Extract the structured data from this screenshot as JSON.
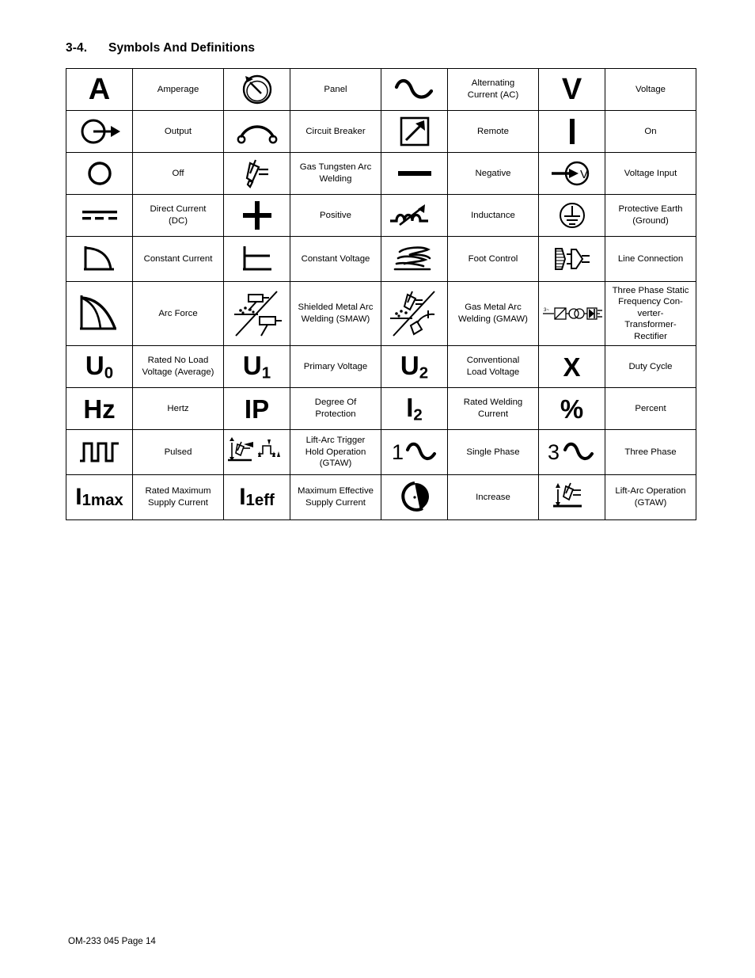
{
  "document": {
    "section_number": "3-4.",
    "section_title": "Symbols And Definitions",
    "footer": "OM-233 045 Page 14"
  },
  "table": {
    "rows": [
      {
        "cells": [
          {
            "symbol": "amperage-A-glyph",
            "symbol_text": "A",
            "label": "Amperage"
          },
          {
            "symbol": "panel-knob-icon",
            "symbol_text": "",
            "label": "Panel"
          },
          {
            "symbol": "alternating-current-sine-icon",
            "symbol_text": "",
            "label": "Alternating\nCurrent (AC)"
          },
          {
            "symbol": "voltage-V-glyph",
            "symbol_text": "V",
            "label": "Voltage"
          }
        ]
      },
      {
        "cells": [
          {
            "symbol": "output-arrow-circle-icon",
            "symbol_text": "",
            "label": "Output"
          },
          {
            "symbol": "circuit-breaker-icon",
            "symbol_text": "",
            "label": "Circuit Breaker"
          },
          {
            "symbol": "remote-arrow-box-icon",
            "symbol_text": "",
            "label": "Remote"
          },
          {
            "symbol": "on-bar-icon",
            "symbol_text": "",
            "label": "On"
          }
        ]
      },
      {
        "cells": [
          {
            "symbol": "off-circle-icon",
            "symbol_text": "",
            "label": "Off"
          },
          {
            "symbol": "gtaw-torch-icon",
            "symbol_text": "",
            "label": "Gas Tungsten Arc\nWelding"
          },
          {
            "symbol": "negative-bar-icon",
            "symbol_text": "",
            "label": "Negative"
          },
          {
            "symbol": "voltage-input-icon",
            "symbol_text": "",
            "label": "Voltage Input"
          }
        ]
      },
      {
        "cells": [
          {
            "symbol": "direct-current-dc-icon",
            "symbol_text": "",
            "label": "Direct Current\n(DC)"
          },
          {
            "symbol": "positive-plus-icon",
            "symbol_text": "",
            "label": "Positive"
          },
          {
            "symbol": "inductance-icon",
            "symbol_text": "",
            "label": "Inductance"
          },
          {
            "symbol": "protective-earth-ground-icon",
            "symbol_text": "",
            "label": "Protective Earth\n(Ground)"
          }
        ]
      },
      {
        "cells": [
          {
            "symbol": "constant-current-curve-icon",
            "symbol_text": "",
            "label": "Constant Current"
          },
          {
            "symbol": "constant-voltage-curve-icon",
            "symbol_text": "",
            "label": "Constant Voltage"
          },
          {
            "symbol": "foot-control-icon",
            "symbol_text": "",
            "label": "Foot Control"
          },
          {
            "symbol": "line-connection-plug-icon",
            "symbol_text": "",
            "label": "Line Connection"
          }
        ]
      },
      {
        "cells": [
          {
            "symbol": "arc-force-curve-icon",
            "symbol_text": "",
            "label": "Arc Force"
          },
          {
            "symbol": "smaw-electrode-icon",
            "symbol_text": "",
            "label": "Shielded Metal Arc\nWelding (SMAW)"
          },
          {
            "symbol": "gmaw-gun-icon",
            "symbol_text": "",
            "label": "Gas Metal Arc\nWelding (GMAW)"
          },
          {
            "symbol": "three-phase-static-converter-icon",
            "symbol_text": "",
            "label": "Three Phase Static\nFrequency Con-\nverter-\nTransformer-\nRectifier"
          }
        ]
      },
      {
        "cells": [
          {
            "symbol": "u-zero-glyph",
            "symbol_text": "U",
            "symbol_sub": "0",
            "label": "Rated No Load\nVoltage (Average)"
          },
          {
            "symbol": "u-one-glyph",
            "symbol_text": "U",
            "symbol_sub": "1",
            "label": "Primary Voltage"
          },
          {
            "symbol": "u-two-glyph",
            "symbol_text": "U",
            "symbol_sub": "2",
            "label": "Conventional\nLoad Voltage"
          },
          {
            "symbol": "duty-cycle-X-glyph",
            "symbol_text": "X",
            "label": "Duty Cycle"
          }
        ]
      },
      {
        "cells": [
          {
            "symbol": "hertz-glyph",
            "symbol_text": "Hz",
            "label": "Hertz"
          },
          {
            "symbol": "ip-glyph",
            "symbol_text": "IP",
            "label": "Degree Of\nProtection"
          },
          {
            "symbol": "i-two-glyph",
            "symbol_text": "I",
            "symbol_sub": "2",
            "label": "Rated Welding\nCurrent"
          },
          {
            "symbol": "percent-glyph",
            "symbol_text": "%",
            "label": "Percent"
          }
        ]
      },
      {
        "cells": [
          {
            "symbol": "pulsed-waveform-icon",
            "symbol_text": "",
            "label": "Pulsed"
          },
          {
            "symbol": "lift-arc-trigger-hold-icon",
            "symbol_text": "",
            "label": "Lift-Arc Trigger\nHold Operation\n(GTAW)"
          },
          {
            "symbol": "single-phase-icon",
            "symbol_text": "1",
            "label": "Single Phase"
          },
          {
            "symbol": "three-phase-icon",
            "symbol_text": "3",
            "label": "Three Phase"
          }
        ]
      },
      {
        "cells": [
          {
            "symbol": "i-1max-glyph",
            "symbol_text": "I",
            "symbol_sub": "1max",
            "label": "Rated Maximum\nSupply Current"
          },
          {
            "symbol": "i-1eff-glyph",
            "symbol_text": "I",
            "symbol_sub": "1eff",
            "label": "Maximum Effective\nSupply Current"
          },
          {
            "symbol": "increase-knob-icon",
            "symbol_text": "",
            "label": "Increase"
          },
          {
            "symbol": "lift-arc-operation-icon",
            "symbol_text": "",
            "label": "Lift-Arc Operation\n(GTAW)"
          }
        ]
      }
    ]
  },
  "colors": {
    "ink": "#000000",
    "paper": "#ffffff"
  }
}
